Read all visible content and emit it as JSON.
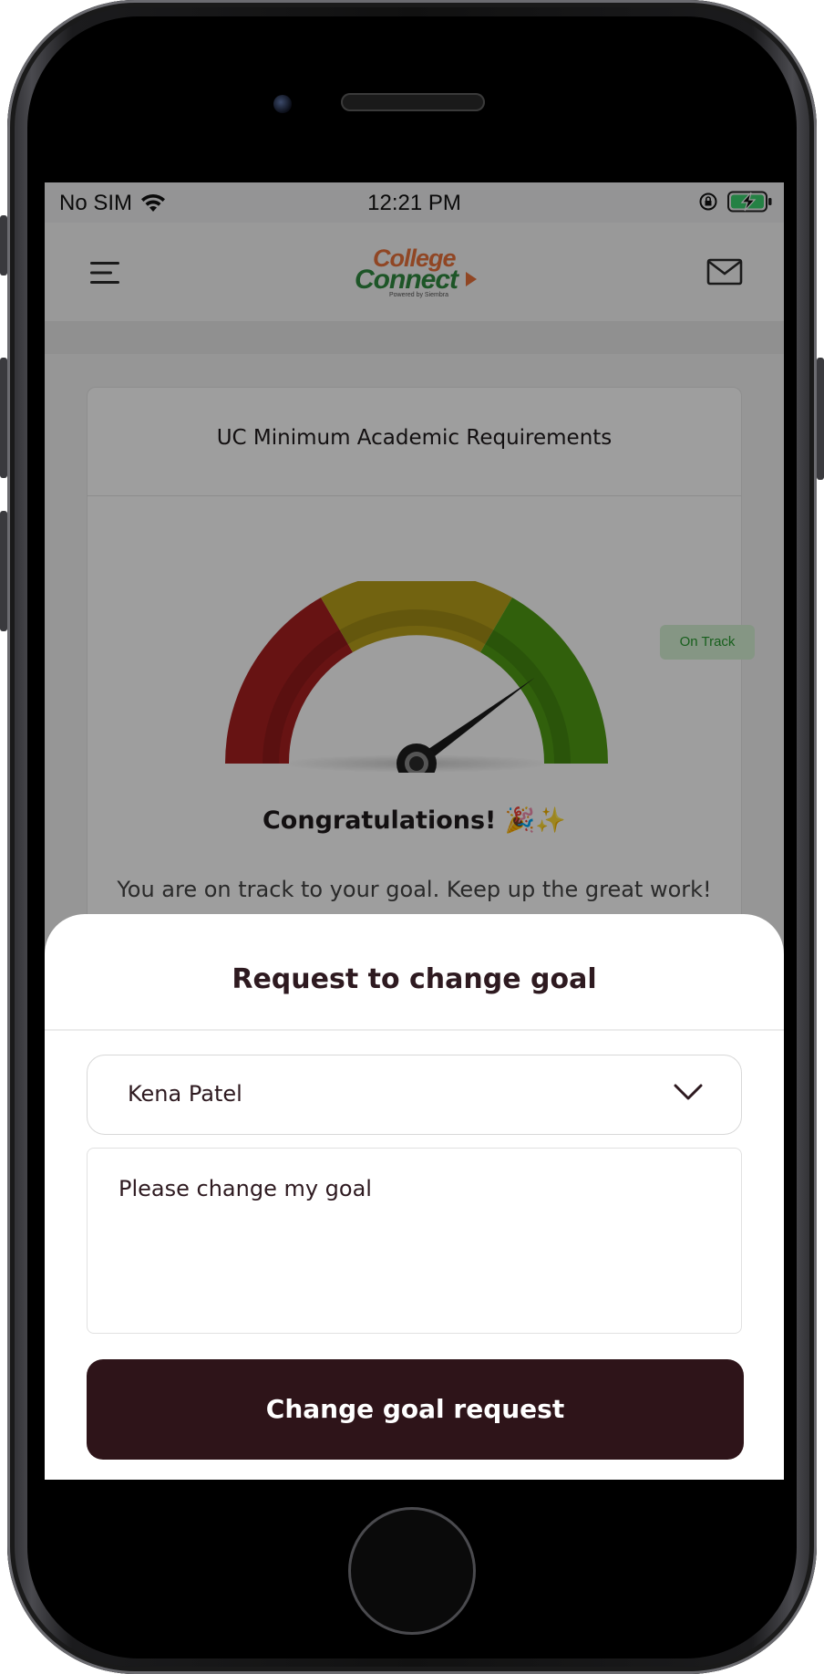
{
  "status_bar": {
    "carrier": "No SIM",
    "time": "12:21 PM",
    "icons": [
      "wifi-icon",
      "orientation-lock-icon",
      "battery-charging-icon"
    ]
  },
  "header": {
    "logo_line1": "College",
    "logo_line2": "Connect",
    "logo_sub": "Powered by Siembra",
    "left_icon": "menu-icon",
    "right_icon": "mail-icon"
  },
  "card": {
    "title": "UC Minimum Academic Requirements",
    "badge": "On Track",
    "congrats": "Congratulations!",
    "congrats_emoji": "🎉✨",
    "message": "You are on track to your goal. Keep up the great work!",
    "gauge_value": 0.8,
    "gauge_colors": [
      "#8c1b1b",
      "#8b7a14",
      "#3b8a12"
    ]
  },
  "sheet": {
    "title": "Request to change goal",
    "select_value": "Kena Patel",
    "textarea_value": "Please change my goal",
    "submit_label": "Change goal request"
  },
  "colors": {
    "primary_dark": "#2e1419",
    "badge_bg": "#d7f3d5",
    "badge_text": "#279a2f"
  }
}
